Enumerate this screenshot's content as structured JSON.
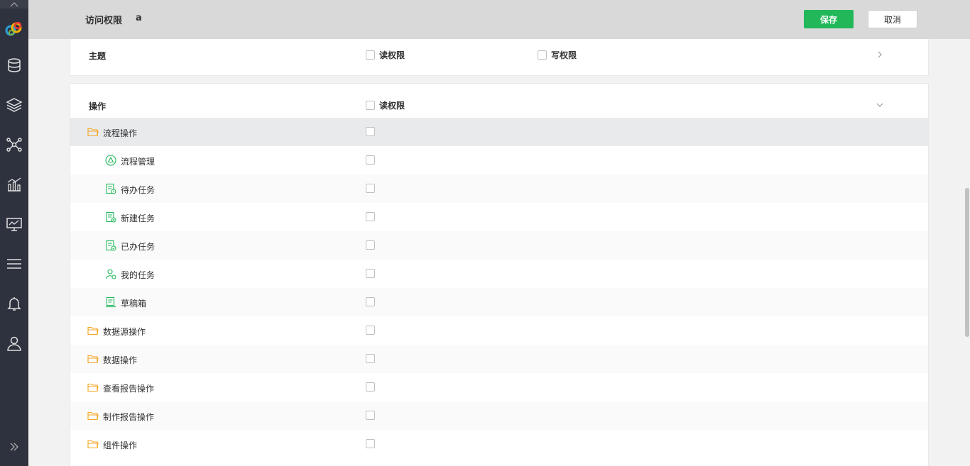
{
  "header": {
    "title": "访问权限",
    "user": "a",
    "save_label": "保存",
    "cancel_label": "取消"
  },
  "colors": {
    "accent": "#22b85a",
    "sidebar": "#2e323e",
    "folder": "#f5a623",
    "green_icon": "#22b85a"
  },
  "sidebar": {
    "items": [
      "database-icon",
      "layers-icon",
      "network-icon",
      "chart-icon",
      "monitor-icon",
      "menu-icon",
      "bell-icon",
      "user-icon"
    ]
  },
  "topic_card": {
    "label": "主题",
    "read_label": "读权限",
    "write_label": "写权限"
  },
  "operation_card": {
    "label": "操作",
    "read_label": "读权限",
    "rows": [
      {
        "label": "流程操作",
        "icon": "folder-icon",
        "level": 0
      },
      {
        "label": "流程管理",
        "icon": "flow-icon",
        "level": 1
      },
      {
        "label": "待办任务",
        "icon": "todo-task-icon",
        "level": 1
      },
      {
        "label": "新建任务",
        "icon": "new-task-icon",
        "level": 1
      },
      {
        "label": "已办任务",
        "icon": "done-task-icon",
        "level": 1
      },
      {
        "label": "我的任务",
        "icon": "my-task-icon",
        "level": 1
      },
      {
        "label": "草稿箱",
        "icon": "draft-icon",
        "level": 1
      },
      {
        "label": "数据源操作",
        "icon": "folder-icon",
        "level": 0
      },
      {
        "label": "数据操作",
        "icon": "folder-icon",
        "level": 0
      },
      {
        "label": "查看报告操作",
        "icon": "folder-icon",
        "level": 0
      },
      {
        "label": "制作报告操作",
        "icon": "folder-icon",
        "level": 0
      },
      {
        "label": "组件操作",
        "icon": "folder-icon",
        "level": 0
      }
    ]
  }
}
